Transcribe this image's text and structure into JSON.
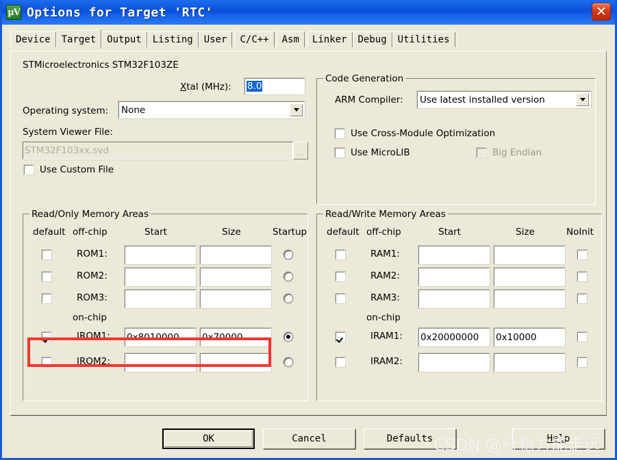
{
  "window": {
    "title": "Options for Target 'RTC'",
    "icon": "uvision-logo-icon",
    "close_label": "✕"
  },
  "tabs": [
    {
      "label": "Device",
      "active": false
    },
    {
      "label": "Target",
      "active": true
    },
    {
      "label": "Output",
      "active": false
    },
    {
      "label": "Listing",
      "active": false
    },
    {
      "label": "User",
      "active": false
    },
    {
      "label": "C/C++",
      "active": false
    },
    {
      "label": "Asm",
      "active": false
    },
    {
      "label": "Linker",
      "active": false
    },
    {
      "label": "Debug",
      "active": false
    },
    {
      "label": "Utilities",
      "active": false
    }
  ],
  "target": {
    "device_text": "STMicroelectronics STM32F103ZE",
    "xtal_label_pre": "X",
    "xtal_label_post": "tal (MHz):",
    "xtal_value": "8.0",
    "os_label": "Operating system:",
    "os_value": "None",
    "sysview_label": "System Viewer File:",
    "sysview_value": "STM32F103xx.svd",
    "browse_label": "...",
    "use_custom_file_label": "Use Custom File",
    "use_custom_file_checked": false
  },
  "code_generation": {
    "title": "Code Generation",
    "arm_compiler_label": "ARM Compiler:",
    "arm_compiler_value": "Use latest installed version",
    "cross_module_label": "Use Cross-Module Optimization",
    "cross_module_checked": false,
    "microlib_label": "Use MicroLIB",
    "microlib_checked": false,
    "big_endian_label": "Big Endian",
    "big_endian_checked": false,
    "big_endian_disabled": true
  },
  "readonly": {
    "title": "Read/Only Memory Areas",
    "col_default": "default",
    "col_offchip": "off-chip",
    "col_start": "Start",
    "col_size": "Size",
    "col_last": "Startup",
    "onchip_label": "on-chip",
    "offchip_rows": [
      {
        "name": "ROM1:",
        "checked": false,
        "start": "",
        "size": "",
        "startup": false
      },
      {
        "name": "ROM2:",
        "checked": false,
        "start": "",
        "size": "",
        "startup": false
      },
      {
        "name": "ROM3:",
        "checked": false,
        "start": "",
        "size": "",
        "startup": false
      }
    ],
    "onchip_rows": [
      {
        "name": "IROM1:",
        "checked": true,
        "start": "0x8010000",
        "size": "0x70000",
        "startup": true,
        "highlighted": true
      },
      {
        "name": "IROM2:",
        "checked": false,
        "start": "",
        "size": "",
        "startup": false,
        "highlighted": false
      }
    ]
  },
  "readwrite": {
    "title": "Read/Write Memory Areas",
    "col_default": "default",
    "col_offchip": "off-chip",
    "col_start": "Start",
    "col_size": "Size",
    "col_last": "NoInit",
    "onchip_label": "on-chip",
    "offchip_rows": [
      {
        "name": "RAM1:",
        "checked": false,
        "start": "",
        "size": "",
        "noinit": false
      },
      {
        "name": "RAM2:",
        "checked": false,
        "start": "",
        "size": "",
        "noinit": false
      },
      {
        "name": "RAM3:",
        "checked": false,
        "start": "",
        "size": "",
        "noinit": false
      }
    ],
    "onchip_rows": [
      {
        "name": "IRAM1:",
        "checked": true,
        "start": "0x20000000",
        "size": "0x10000",
        "noinit": false
      },
      {
        "name": "IRAM2:",
        "checked": false,
        "start": "",
        "size": "",
        "noinit": false
      }
    ]
  },
  "footer": {
    "ok_label": "OK",
    "cancel_label": "Cancel",
    "defaults_label": "Defaults",
    "help_label_pre": "Hel",
    "help_label_post": "p",
    "watermark": "CSDN @行稳方能走远"
  },
  "colors": {
    "titlebar": "#0a4fd8",
    "dialog_face": "#ece9d8",
    "highlight_red": "#f4352e",
    "selection_blue": "#1565d8"
  }
}
